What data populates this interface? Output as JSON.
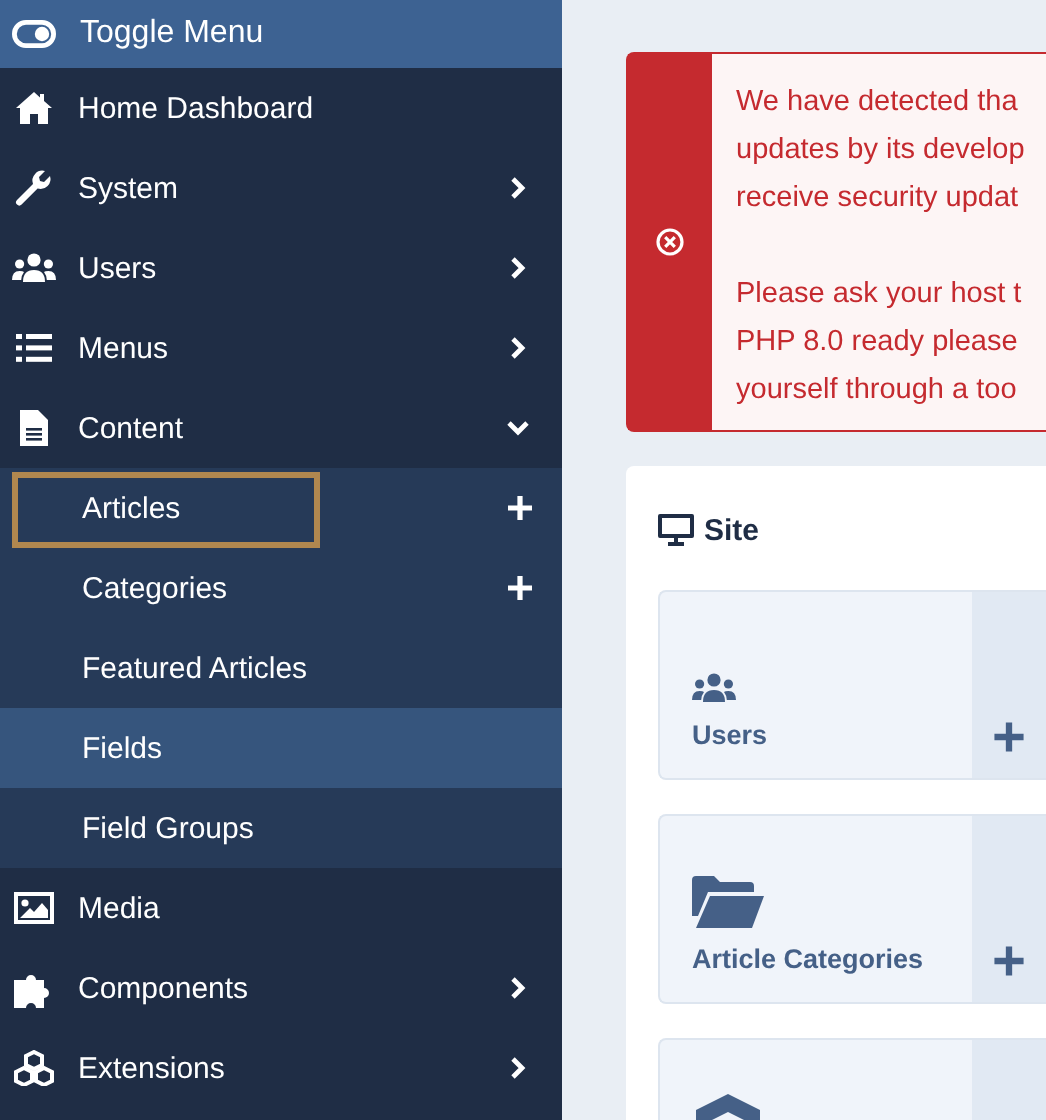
{
  "sidebar": {
    "toggle": {
      "label": "Toggle Menu"
    },
    "items": [
      {
        "label": "Home Dashboard",
        "kind": "home",
        "submenu": false
      },
      {
        "label": "System",
        "kind": "wrench",
        "submenu": true,
        "expanded": false
      },
      {
        "label": "Users",
        "kind": "users",
        "submenu": true,
        "expanded": false
      },
      {
        "label": "Menus",
        "kind": "list",
        "submenu": true,
        "expanded": false
      },
      {
        "label": "Content",
        "kind": "file",
        "submenu": true,
        "expanded": true,
        "children": [
          {
            "label": "Articles",
            "add": true,
            "selected": false,
            "highlighted": true
          },
          {
            "label": "Categories",
            "add": true,
            "selected": false,
            "highlighted": false
          },
          {
            "label": "Featured Articles",
            "add": false,
            "selected": false,
            "highlighted": false
          },
          {
            "label": "Fields",
            "add": false,
            "selected": true,
            "highlighted": false
          },
          {
            "label": "Field Groups",
            "add": false,
            "selected": false,
            "highlighted": false
          }
        ]
      },
      {
        "label": "Media",
        "kind": "image",
        "submenu": false
      },
      {
        "label": "Components",
        "kind": "puzzle",
        "submenu": true,
        "expanded": false
      },
      {
        "label": "Extensions",
        "kind": "cubes",
        "submenu": true,
        "expanded": false
      }
    ]
  },
  "alert": {
    "kind": "error",
    "paragraphs": [
      [
        "We have detected tha",
        "updates by its develop",
        "receive security updat"
      ],
      [
        "Please ask your host t",
        "PHP 8.0 ready please",
        "yourself through a too"
      ]
    ]
  },
  "site_panel": {
    "title": "Site",
    "tiles": [
      {
        "label": "Users",
        "kind": "users",
        "add": true
      },
      {
        "label": "Article Categories",
        "kind": "folder",
        "add": true
      },
      {
        "kind": "cube"
      }
    ]
  }
}
